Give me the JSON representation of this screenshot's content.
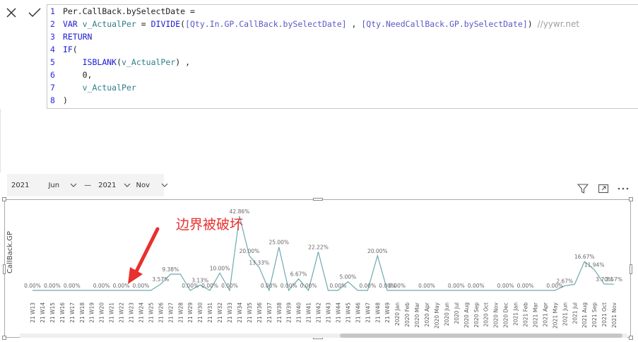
{
  "formula": {
    "lines": [
      {
        "n": "1",
        "segments": [
          {
            "t": "Per.CallBack.bySelectDate =",
            "c": "tok-plain"
          }
        ]
      },
      {
        "n": "2",
        "segments": [
          {
            "t": "VAR ",
            "c": "tok-kw"
          },
          {
            "t": "v_ActualPer",
            "c": "tok-var"
          },
          {
            "t": " = ",
            "c": "tok-plain"
          },
          {
            "t": "DIVIDE",
            "c": "tok-fn"
          },
          {
            "t": "(",
            "c": "tok-plain"
          },
          {
            "t": "[Qty.In.GP.CallBack.bySelectDate]",
            "c": "tok-ref"
          },
          {
            "t": " , ",
            "c": "tok-plain"
          },
          {
            "t": "[Qty.NeedCallBack.GP.bySelectDate]",
            "c": "tok-ref"
          },
          {
            "t": ") ",
            "c": "tok-plain"
          },
          {
            "t": "//yywr.net",
            "c": "tok-cmt"
          }
        ]
      },
      {
        "n": "3",
        "segments": [
          {
            "t": "RETURN",
            "c": "tok-kw"
          }
        ]
      },
      {
        "n": "4",
        "segments": [
          {
            "t": "IF",
            "c": "tok-fn"
          },
          {
            "t": "(",
            "c": "tok-plain"
          }
        ]
      },
      {
        "n": "5",
        "segments": [
          {
            "t": "    ISBLANK",
            "c": "tok-fn"
          },
          {
            "t": "(",
            "c": "tok-plain"
          },
          {
            "t": "v_ActualPer",
            "c": "tok-var"
          },
          {
            "t": ") ,",
            "c": "tok-plain"
          }
        ]
      },
      {
        "n": "6",
        "segments": [
          {
            "t": "    0,",
            "c": "tok-num"
          }
        ]
      },
      {
        "n": "7",
        "segments": [
          {
            "t": "    v_ActualPer",
            "c": "tok-var"
          }
        ]
      },
      {
        "n": "8",
        "segments": [
          {
            "t": ")",
            "c": "tok-plain"
          }
        ]
      }
    ]
  },
  "slicer": {
    "start_year": "2021",
    "start_month": "Jun",
    "separator": "—",
    "end_year": "2021",
    "end_month": "Nov"
  },
  "icons": {
    "cancel": "close-icon",
    "commit": "check-icon",
    "filter": "filter-icon",
    "focus": "focus-mode-icon",
    "more": "more-options-icon"
  },
  "annotation": {
    "text": "边界被破坏",
    "color": "#e8302e"
  },
  "chart_data": {
    "type": "line",
    "ylabel": "CallBack.GP",
    "line_color": "#6fa8b0",
    "categories": [
      "21 W13",
      "21 W14",
      "21 W15",
      "21 W16",
      "21 W17",
      "21 W18",
      "21 W19",
      "21 W20",
      "21 W21",
      "21 W22",
      "21 W23",
      "21 W24",
      "21 W25",
      "21 W26",
      "21 W27",
      "21 W28",
      "21 W29",
      "21 W30",
      "21 W31",
      "21 W32",
      "21 W33",
      "21 W34",
      "21 W35",
      "21 W36",
      "21 W37",
      "21 W38",
      "21 W39",
      "21 W40",
      "21 W41",
      "21 W42",
      "21 W43",
      "21 W44",
      "21 W45",
      "21 W46",
      "21 W47",
      "21 W48",
      "21 W49",
      "2020 Jan",
      "2020 Feb",
      "2020 Mar",
      "2020 Apr",
      "2020 May",
      "2020 Jun",
      "2020 Jul",
      "2020 Aug",
      "2020 Sep",
      "2020 Oct",
      "2020 Nov",
      "2020 Dec",
      "2021 Jan",
      "2021 Feb",
      "2021 Mar",
      "2021 Apr",
      "2021 May",
      "2021 Jun",
      "2021 Jul",
      "2021 Aug",
      "2021 Sep",
      "2021 Oct",
      "2021 Nov"
    ],
    "values": [
      0,
      0,
      0,
      0,
      0,
      0,
      0,
      0,
      0,
      0,
      0,
      0,
      0,
      3.57,
      9.38,
      9.38,
      0,
      3.13,
      0,
      10.0,
      0,
      42.86,
      20.0,
      13.33,
      0,
      25.0,
      0,
      6.67,
      0,
      22.22,
      0,
      0,
      5.0,
      0,
      0,
      20.0,
      0,
      0,
      0,
      0,
      0,
      0,
      0,
      0,
      0,
      0,
      0,
      0,
      0,
      0,
      0,
      0,
      0,
      0,
      2.67,
      3.5,
      16.67,
      11.94,
      3.7,
      3.57
    ],
    "labels": [
      {
        "i": 0,
        "text": "0.00%"
      },
      {
        "i": 2,
        "text": "0.00%"
      },
      {
        "i": 4,
        "text": "0.00%"
      },
      {
        "i": 7,
        "text": "0.00%"
      },
      {
        "i": 9,
        "text": "0.00%"
      },
      {
        "i": 11,
        "text": "0.00%"
      },
      {
        "i": 13,
        "text": "3.57%"
      },
      {
        "i": 14,
        "text": "9.38%"
      },
      {
        "i": 16,
        "text": "0.00%"
      },
      {
        "i": 17,
        "text": "3.13%"
      },
      {
        "i": 18,
        "text": "0.00%"
      },
      {
        "i": 19,
        "text": "10.00%"
      },
      {
        "i": 20,
        "text": "0.00%"
      },
      {
        "i": 21,
        "text": "42.86%"
      },
      {
        "i": 22,
        "text": "20.00%"
      },
      {
        "i": 23,
        "text": "13.33%"
      },
      {
        "i": 24,
        "text": "0.00%"
      },
      {
        "i": 25,
        "text": "25.00%"
      },
      {
        "i": 26,
        "text": "0.00%"
      },
      {
        "i": 27,
        "text": "6.67%"
      },
      {
        "i": 28,
        "text": "0.00%"
      },
      {
        "i": 29,
        "text": "22.22%"
      },
      {
        "i": 31,
        "text": "0.00%"
      },
      {
        "i": 32,
        "text": "5.00%"
      },
      {
        "i": 34,
        "text": "0.00%"
      },
      {
        "i": 35,
        "text": "20.00%"
      },
      {
        "i": 36,
        "text": "0.00%"
      },
      {
        "i": 37,
        "text": "0.00%"
      },
      {
        "i": 40,
        "text": "0.00%"
      },
      {
        "i": 43,
        "text": "0.00%"
      },
      {
        "i": 45,
        "text": "0.00%"
      },
      {
        "i": 48,
        "text": "0.00%"
      },
      {
        "i": 50,
        "text": "0.00%"
      },
      {
        "i": 53,
        "text": "0.00%"
      },
      {
        "i": 54,
        "text": "2.67%"
      },
      {
        "i": 56,
        "text": "16.67%"
      },
      {
        "i": 57,
        "text": "11.94%"
      },
      {
        "i": 58,
        "text": "3.70%"
      },
      {
        "i": 59,
        "text": "3.57%"
      }
    ],
    "ylim": [
      0,
      44
    ],
    "grid": false,
    "legend": "none"
  }
}
